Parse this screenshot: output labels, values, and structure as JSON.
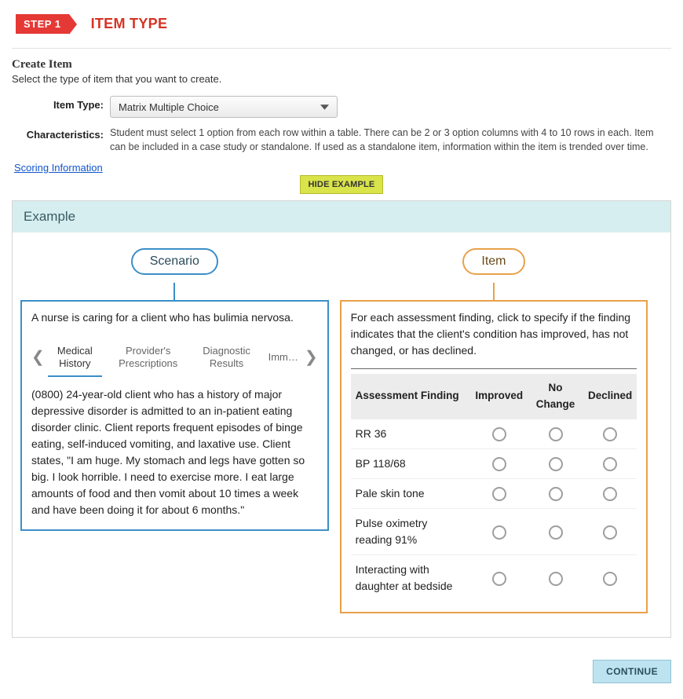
{
  "step": {
    "badge": "STEP 1",
    "title": "ITEM TYPE"
  },
  "create": {
    "heading": "Create Item",
    "sub": "Select the type of item that you want to create."
  },
  "fields": {
    "item_type_label": "Item Type:",
    "item_type_value": "Matrix Multiple Choice",
    "characteristics_label": "Characteristics:",
    "characteristics_text": "Student must select 1 option from each row within a table. There can be 2 or 3 option columns with 4 to 10 rows in each. Item can be included in a case study or standalone. If used as a standalone item, information within the item is trended over time."
  },
  "links": {
    "scoring": "Scoring Information"
  },
  "buttons": {
    "hide_example": "HIDE EXAMPLE",
    "continue": "CONTINUE"
  },
  "example": {
    "header": "Example",
    "scenario_label": "Scenario",
    "item_label": "Item",
    "scenario": {
      "lead": "A nurse is caring for a client who has bulimia nervosa.",
      "tabs": [
        "Medical History",
        "Provider's Prescriptions",
        "Diagnostic Results",
        "Imm…"
      ],
      "active_tab": 0,
      "body": "(0800) 24-year-old client who has a history of major depressive disorder is admitted to an in-patient eating disorder clinic. Client reports frequent episodes of binge eating, self-induced vomiting, and laxative use. Client states, \"I am huge. My stomach and legs have gotten so big. I look horrible. I need to exercise more. I eat large amounts of food and then vomit about 10 times a week and have been doing it for about 6 months.\""
    },
    "item": {
      "lead": "For each assessment finding, click to specify if the finding indicates that the client's condition has improved, has not changed, or has declined.",
      "columns": [
        "Assessment Finding",
        "Improved",
        "No Change",
        "Declined"
      ],
      "rows": [
        "RR 36",
        "BP 118/68",
        "Pale skin tone",
        "Pulse oximetry reading 91%",
        "Interacting with daughter at bedside"
      ]
    }
  }
}
